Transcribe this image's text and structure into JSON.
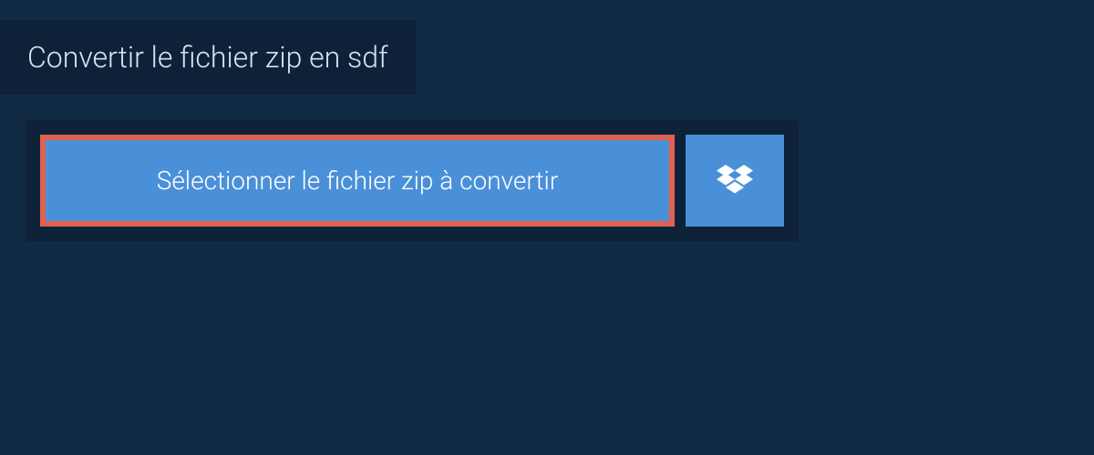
{
  "header": {
    "title": "Convertir le fichier zip en sdf"
  },
  "uploader": {
    "select_label": "Sélectionner le fichier zip à convertir"
  },
  "colors": {
    "page_bg": "#102a43",
    "panel_bg": "#0d2238",
    "button_bg": "#4a90d9",
    "highlight_border": "#e0614e",
    "text_light": "#d9e2ec",
    "text_white": "#ffffff"
  }
}
